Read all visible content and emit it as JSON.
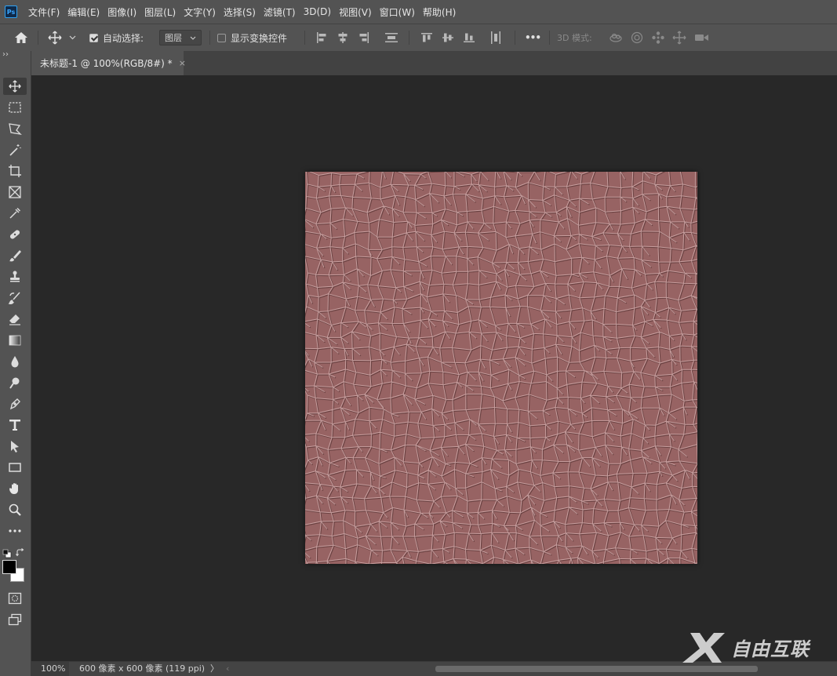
{
  "app": {
    "logo_text": "Ps"
  },
  "menu": [
    "文件(F)",
    "编辑(E)",
    "图像(I)",
    "图层(L)",
    "文字(Y)",
    "选择(S)",
    "滤镜(T)",
    "3D(D)",
    "视图(V)",
    "窗口(W)",
    "帮助(H)"
  ],
  "options_bar": {
    "auto_select_label": "自动选择:",
    "auto_select_checked": true,
    "auto_select_target": "图层",
    "show_transform_label": "显示变换控件",
    "show_transform_checked": false,
    "more_label": "•••",
    "mode_3d_label": "3D 模式:"
  },
  "document_tab": {
    "title": "未标题-1 @ 100%(RGB/8#) *",
    "close": "×"
  },
  "toolbar": {
    "grip": "››",
    "tools": [
      "move-tool",
      "rectangular-marquee-tool",
      "polygonal-lasso-tool",
      "magic-wand-tool",
      "crop-tool",
      "frame-tool",
      "eyedropper-tool",
      "spot-healing-tool",
      "brush-tool",
      "clone-stamp-tool",
      "history-brush-tool",
      "eraser-tool",
      "gradient-tool",
      "blur-tool",
      "dodge-tool",
      "pen-tool",
      "type-tool",
      "path-selection-tool",
      "rectangle-tool",
      "hand-tool",
      "zoom-tool",
      "edit-toolbar"
    ],
    "active_tool": "move-tool",
    "foreground_color": "#000000",
    "background_color": "#ffffff"
  },
  "canvas": {
    "texture_color": "#9b6565",
    "background": "#282828"
  },
  "status": {
    "zoom": "100%",
    "doc_info": "600 像素 x 600 像素 (119 ppi)",
    "arrow": "〉",
    "scroll_left": "‹"
  },
  "watermark": {
    "text": "自由互联"
  }
}
